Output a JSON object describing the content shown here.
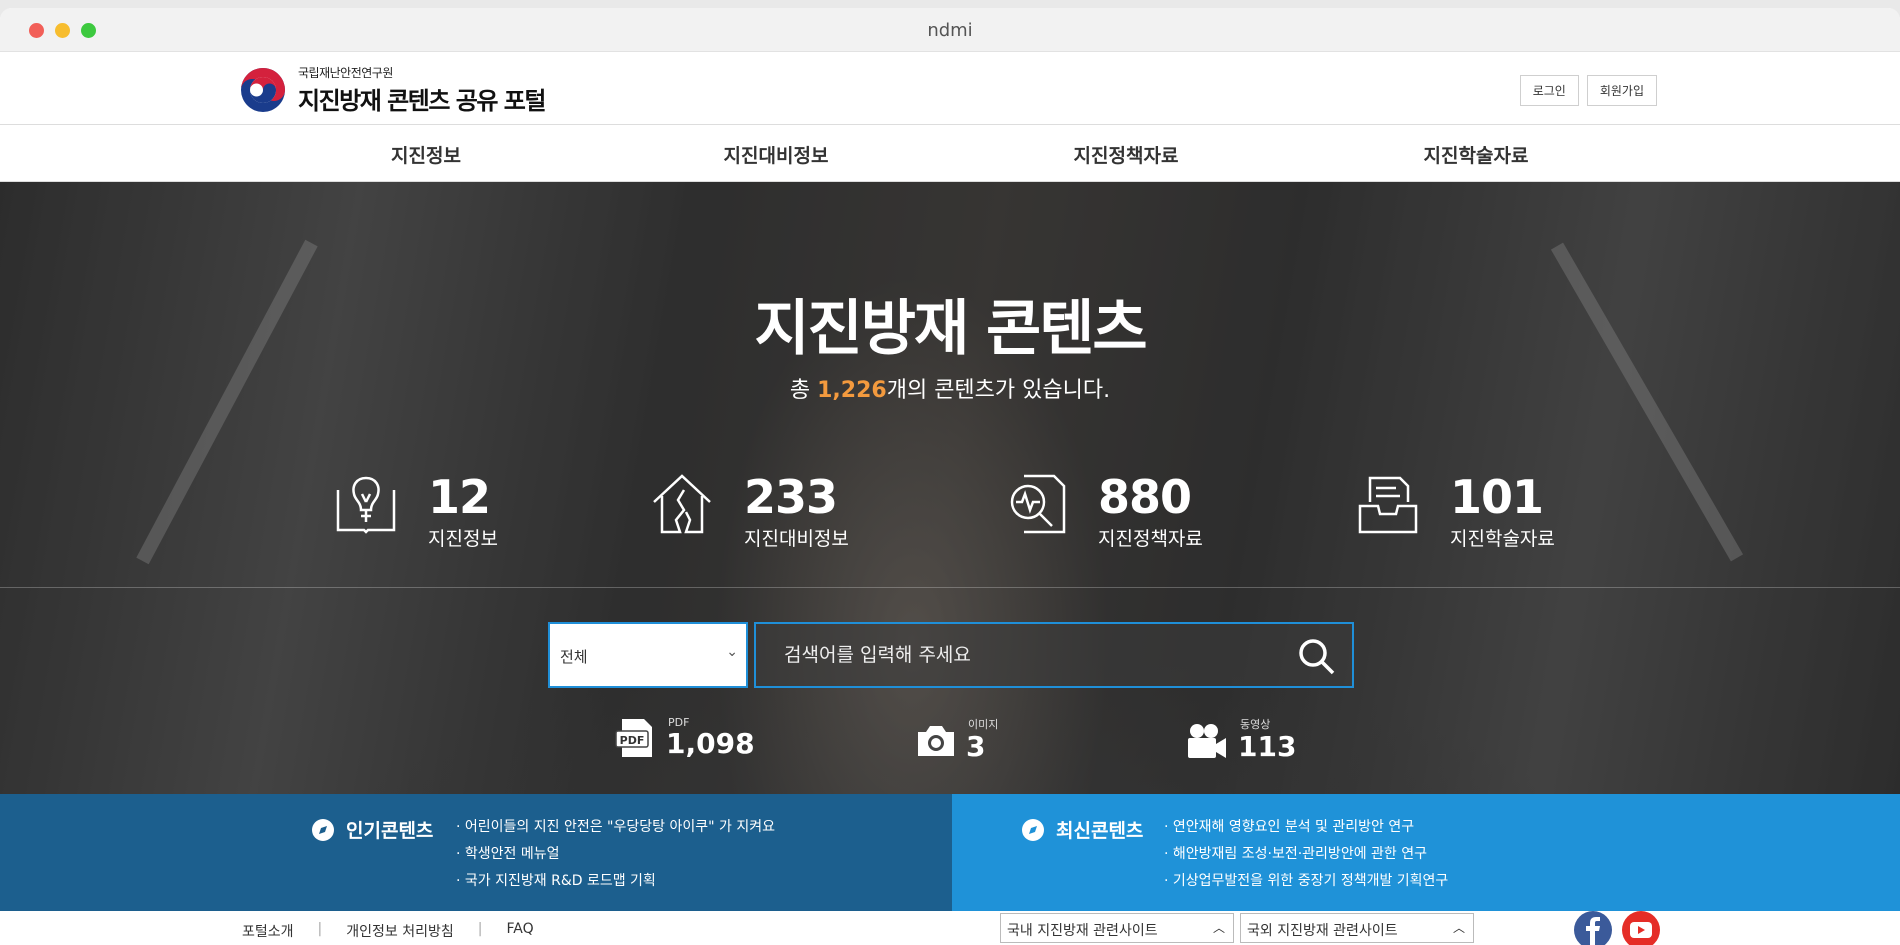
{
  "window": {
    "title": "ndmi"
  },
  "header": {
    "logo_sub": "국립재난안전연구원",
    "logo_main": "지진방재 콘텐츠 공유 포털",
    "login_label": "로그인",
    "signup_label": "회원가입"
  },
  "nav": {
    "items": [
      {
        "label": "지진정보"
      },
      {
        "label": "지진대비정보"
      },
      {
        "label": "지진정책자료"
      },
      {
        "label": "지진학술자료"
      }
    ]
  },
  "hero": {
    "title": "지진방재 콘텐츠",
    "sub_prefix": "총 ",
    "total_count": "1,226",
    "sub_suffix": "개의 콘텐츠가 있습니다.",
    "stats": [
      {
        "icon": "lightbulb-book-icon",
        "value": "12",
        "label": "지진정보"
      },
      {
        "icon": "cracked-house-icon",
        "value": "233",
        "label": "지진대비정보"
      },
      {
        "icon": "document-magnifier-icon",
        "value": "880",
        "label": "지진정책자료"
      },
      {
        "icon": "file-tray-icon",
        "value": "101",
        "label": "지진학술자료"
      }
    ]
  },
  "search": {
    "category_selected": "전체",
    "placeholder": "검색어를 입력해 주세요",
    "accent_color": "#1f8fd8"
  },
  "media": [
    {
      "icon": "pdf-icon",
      "label": "PDF",
      "value": "1,098"
    },
    {
      "icon": "camera-icon",
      "label": "이미지",
      "value": "3"
    },
    {
      "icon": "video-camera-icon",
      "label": "동영상",
      "value": "113"
    }
  ],
  "popular": {
    "title": "인기콘텐츠",
    "items": [
      "어린이들의 지진 안전은 \"우당당탕 아이쿠\" 가 지켜요",
      "학생안전 메뉴얼",
      "국가 지진방재 R&D 로드맵 기획"
    ],
    "color": "#1c5f8e"
  },
  "latest": {
    "title": "최신콘텐츠",
    "items": [
      "연안재해 영향요인 분석 및 관리방안 연구",
      "해안방재림 조성·보전·관리방안에 관한 연구",
      "기상업무발전을 위한 중장기 정책개발 기획연구"
    ],
    "color": "#1f92d8"
  },
  "footer": {
    "links": [
      "포털소개",
      "개인정보 처리방침",
      "FAQ"
    ],
    "domestic_select": "국내 지진방재 관련사이트",
    "foreign_select": "국외 지진방재 관련사이트"
  }
}
